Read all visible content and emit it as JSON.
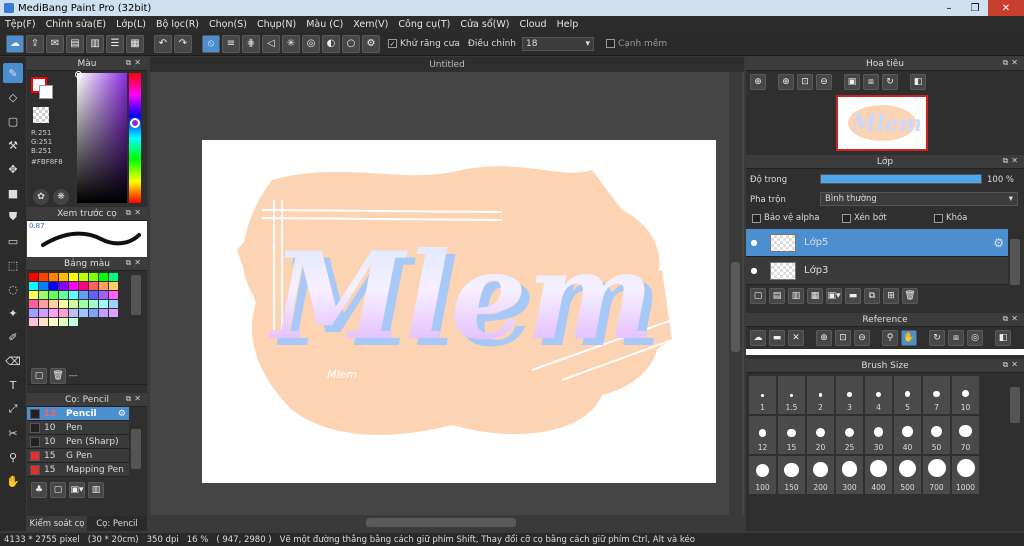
{
  "window": {
    "title": "MediBang Paint Pro (32bit)",
    "minimize": "–",
    "maximize": "❐",
    "close": "✕"
  },
  "menu": [
    "Tệp(F)",
    "Chỉnh sửa(E)",
    "Lớp(L)",
    "Bộ lọc(R)",
    "Chọn(S)",
    "Chụp(N)",
    "Màu (C)",
    "Xem(V)",
    "Công cụ(T)",
    "Cửa sổ(W)",
    "Cloud",
    "Help"
  ],
  "toolbar": {
    "antialias_label": "Khử răng cưa",
    "correction_label": "Điều chỉnh",
    "correction_value": "18",
    "edge_label": "Cạnh mềm"
  },
  "doc": {
    "tab_title": "Untitled"
  },
  "color_panel": {
    "title": "Màu",
    "r": "R:251",
    "g": "G:251",
    "b": "B:251",
    "hex": "#FBF8F8",
    "main_color": "#ff0000",
    "sub_color": "#ffffff"
  },
  "brush_preview": {
    "title": "Xem trước cọ",
    "size": "0.87"
  },
  "palette": {
    "title": "Bảng màu",
    "extra": "---",
    "colors": [
      "#ff0000",
      "#ff4000",
      "#ff8000",
      "#ffbf00",
      "#ffff00",
      "#c0ff00",
      "#80ff00",
      "#00ff00",
      "#00ff80",
      "#00ffff",
      "#0080ff",
      "#0000ff",
      "#8000ff",
      "#ff00ff",
      "#ff0080",
      "#ff6060",
      "#ff9f60",
      "#ffd060",
      "#ffff60",
      "#a0ff60",
      "#60ff60",
      "#60ffa0",
      "#60ffff",
      "#60a0ff",
      "#6060ff",
      "#a060ff",
      "#ff60ff",
      "#ff60a0",
      "#ffa0a0",
      "#ffd0a0",
      "#ffffa0",
      "#d0ffa0",
      "#a0ffa0",
      "#a0ffd0",
      "#a0ffff",
      "#a0d0ff",
      "#a0a0ff",
      "#d0a0ff",
      "#ffa0ff",
      "#ffa0d0",
      "#c0c0ff",
      "#a0c0ff",
      "#80a0ff",
      "#c0a0ff",
      "#e0a0ff",
      "#ffc0e0",
      "#ffe0c0",
      "#ffffc0",
      "#e0ffc0",
      "#c0ffe0"
    ]
  },
  "brush_panel": {
    "title": "Cọ: Pencil",
    "items": [
      {
        "size": "12",
        "name": "Pencil",
        "color": "#222222",
        "selected": true
      },
      {
        "size": "10",
        "name": "Pen",
        "color": "#222222"
      },
      {
        "size": "10",
        "name": "Pen (Sharp)",
        "color": "#222222"
      },
      {
        "size": "15",
        "name": "G Pen",
        "color": "#e03030"
      },
      {
        "size": "15",
        "name": "Mapping Pen",
        "color": "#e03030"
      }
    ]
  },
  "left_tabs": [
    "Kiểm soát cọ",
    "Cọ: Pencil"
  ],
  "artwork": {
    "word": "Mlem",
    "signature": "Mlem"
  },
  "navigator": {
    "title": "Hoa tiêu"
  },
  "layer_panel": {
    "title": "Lớp",
    "opacity_label": "Độ trong",
    "opacity_value": "100 %",
    "opacity": 1.0,
    "blend_label": "Pha trộn",
    "blend_value": "Bình thường",
    "protect_alpha": "Bảo vệ alpha",
    "clip": "Xén bớt",
    "lock": "Khóa",
    "layers": [
      {
        "name": "Lớp5",
        "selected": true
      },
      {
        "name": "Lớp3",
        "selected": false
      }
    ]
  },
  "reference": {
    "title": "Reference"
  },
  "brush_size": {
    "title": "Brush Size",
    "rows": [
      [
        "1",
        "1.5",
        "2",
        "3",
        "4",
        "5",
        "7",
        "10"
      ],
      [
        "12",
        "15",
        "20",
        "25",
        "30",
        "40",
        "50",
        "70"
      ],
      [
        "100",
        "150",
        "200",
        "300",
        "400",
        "500",
        "700",
        "1000"
      ]
    ]
  },
  "status": {
    "size": "4133 * 2755 pixel",
    "cm": "(30 * 20cm)",
    "dpi": "350 dpi",
    "zoom": "16 %",
    "coords": "( 947, 2980 )",
    "hint": "Vẽ một đường thẳng bằng cách giữ phím Shift, Thay đổi cỡ cọ bằng cách giữ phím Ctrl, Alt và kéo"
  }
}
